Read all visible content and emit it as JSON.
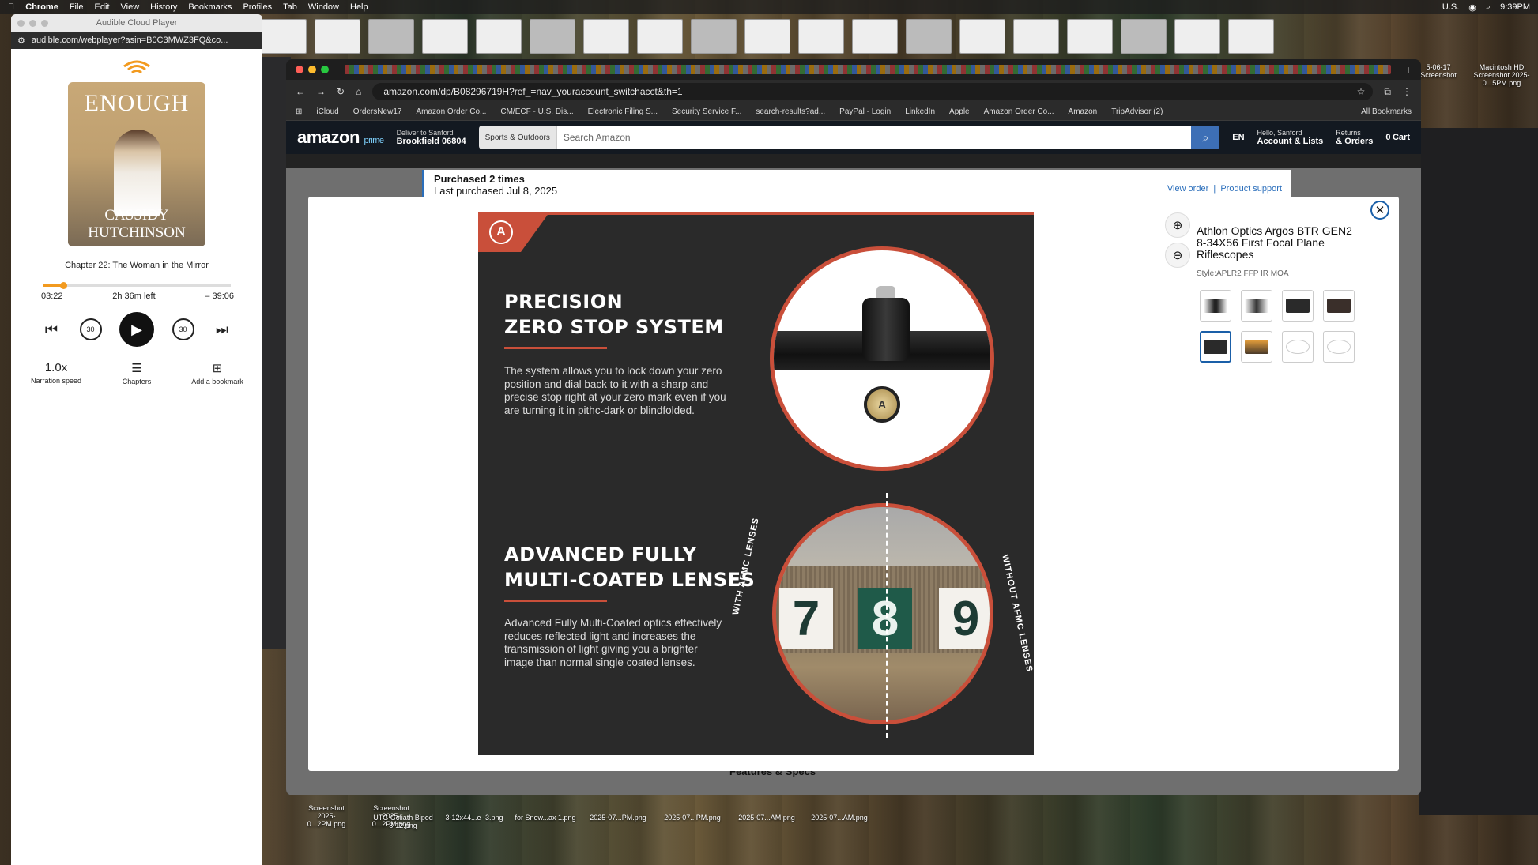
{
  "menubar": {
    "app": "Chrome",
    "items": [
      "File",
      "Edit",
      "View",
      "History",
      "Bookmarks",
      "Profiles",
      "Tab",
      "Window",
      "Help"
    ],
    "locale": "U.S.",
    "time": "9:39PM"
  },
  "audible": {
    "window_title": "Audible Cloud Player",
    "url": "audible.com/webplayer?asin=B0C3MWZ3FQ&co...",
    "cover_title": "ENOUGH",
    "cover_author": "CASSIDY HUTCHINSON",
    "chapter": "Chapter 22: The Woman in the Mirror",
    "progress_fraction": 0.11,
    "elapsed": "03:22",
    "left": "2h 36m left",
    "remaining": "– 39:06",
    "skip_back": "30",
    "skip_fwd": "30",
    "speed_value": "1.0x",
    "speed_label": "Narration speed",
    "chapters_label": "Chapters",
    "bookmark_label": "Add a bookmark"
  },
  "chrome": {
    "url": "amazon.com/dp/B08296719H?ref_=nav_youraccount_switchacct&th=1",
    "bookmarks": [
      "iCloud",
      "OrdersNew17",
      "Amazon Order Co...",
      "CM/ECF - U.S. Dis...",
      "Electronic Filing S...",
      "Security Service F...",
      "search-results?ad...",
      "PayPal - Login",
      "LinkedIn",
      "Apple",
      "Amazon Order Co...",
      "Amazon",
      "TripAdvisor (2)"
    ],
    "all_bookmarks": "All Bookmarks"
  },
  "amazon": {
    "logo": "amazon",
    "logo_sub": "prime",
    "deliver_to": "Deliver to Sanford",
    "deliver_loc": "Brookfield 06804",
    "search_category": "Sports & Outdoors",
    "search_placeholder": "Search Amazon",
    "lang": "EN",
    "hello": "Hello, Sanford",
    "account": "Account & Lists",
    "returns": "Returns",
    "orders": "& Orders",
    "cart_count": "0",
    "cart": "Cart",
    "purchased_times": "Purchased 2 times",
    "last_purchased": "Last purchased Jul 8, 2025",
    "view_order": "View order",
    "product_support": "Product support",
    "features_specs": "Features & Specs"
  },
  "modal": {
    "heading1_line1": "PRECISION",
    "heading1_line2": "ZERO STOP SYSTEM",
    "body1": "The system allows you to lock down your zero position and dial back to it with a sharp and precise stop right at your zero mark even if you are turning it in pithc-dark or blindfolded.",
    "heading2_line1": "ADVANCED FULLY",
    "heading2_line2": "MULTI-COATED LENSES",
    "body2": "Advanced Fully Multi-Coated optics effectively reduces reflected light and increases the transmission of light giving you a brighter image than normal single coated lenses.",
    "with_label": "WITH AFMC LENSES",
    "without_label": "WITHOUT AFMC LENSES",
    "target_numbers": [
      "7",
      "8",
      "9"
    ],
    "product_title": "Athlon Optics Argos BTR GEN2 8-34X56 First Focal Plane Riflescopes",
    "style": "Style:APLR2 FFP IR MOA"
  },
  "desktop": {
    "right_labels": [
      "5-06-17 Screenshot",
      "Macintosh HD Screenshot 2025-0...5PM.png"
    ],
    "bottom_labels": [
      "Screenshot 2025-0...2PM.png",
      "Screenshot 2025-0...2PM.png",
      "UTG Goliath Bipod 8-12.png",
      "3-12x44...e -3.png",
      "for Snow...ax 1.png",
      "2025-07...PM.png",
      "2025-07...PM.png",
      "2025-07...AM.png",
      "2025-07...AM.png"
    ]
  },
  "colors": {
    "accent": "#c94f3a",
    "amazon_header": "#131921",
    "audible_orange": "#f29a1f"
  }
}
